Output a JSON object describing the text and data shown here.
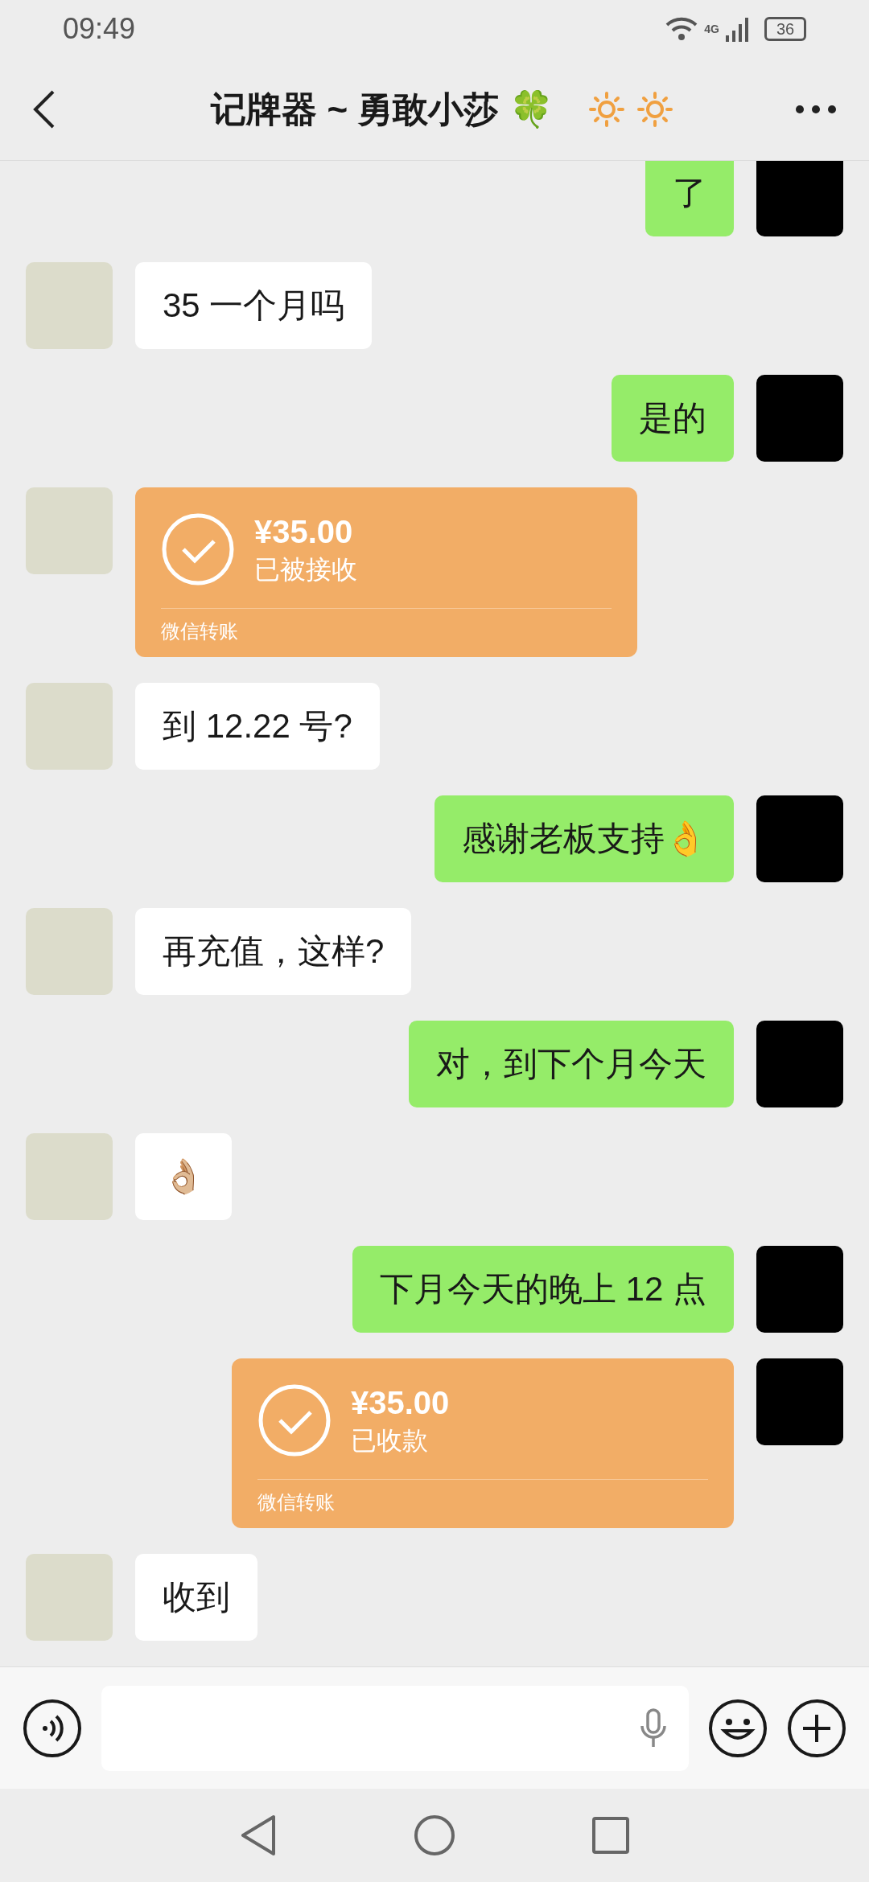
{
  "status_bar": {
    "time": "09:49",
    "network": "4G",
    "battery": "36"
  },
  "header": {
    "title": "记牌器 ~ 勇敢小莎 🍀"
  },
  "messages": [
    {
      "outgoing": true,
      "kind": "text",
      "text": "了"
    },
    {
      "outgoing": false,
      "kind": "text",
      "text": "35 一个月吗"
    },
    {
      "outgoing": true,
      "kind": "text",
      "text": "是的"
    },
    {
      "outgoing": false,
      "kind": "transfer",
      "amount": "¥35.00",
      "status": "已被接收",
      "label": "微信转账"
    },
    {
      "outgoing": false,
      "kind": "text",
      "text": "到 12.22 号?"
    },
    {
      "outgoing": true,
      "kind": "text",
      "text": "感谢老板支持👌"
    },
    {
      "outgoing": false,
      "kind": "text",
      "text": "再充值，这样?"
    },
    {
      "outgoing": true,
      "kind": "text",
      "text": "对，到下个月今天"
    },
    {
      "outgoing": false,
      "kind": "text",
      "text": "👌🏼"
    },
    {
      "outgoing": true,
      "kind": "text",
      "text": "下月今天的晚上 12 点"
    },
    {
      "outgoing": true,
      "kind": "transfer",
      "amount": "¥35.00",
      "status": "已收款",
      "label": "微信转账"
    },
    {
      "outgoing": false,
      "kind": "text",
      "text": "收到"
    }
  ]
}
